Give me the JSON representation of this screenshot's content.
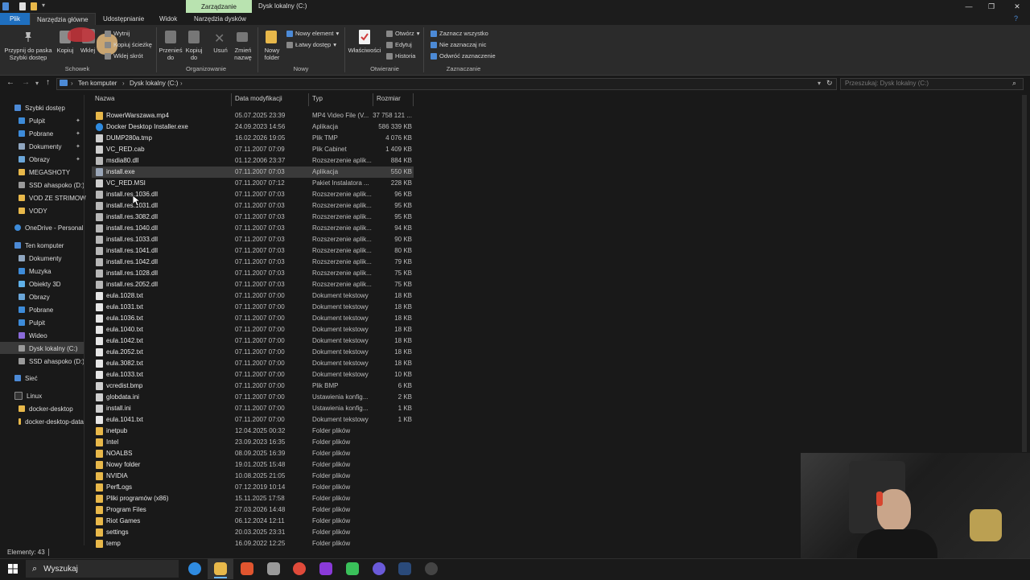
{
  "window": {
    "contextual_tab": "Zarządzanie",
    "title": "Dysk lokalny (C:)",
    "controls": {
      "minimize": "—",
      "restore": "❐",
      "close": "✕"
    }
  },
  "ribbon_tabs": [
    "Plik",
    "Narzędzia główne",
    "Udostępnianie",
    "Widok",
    "Narzędzia dysków"
  ],
  "ribbon": {
    "clipboard": {
      "pin": "Przypnij do paska Szybki dostęp",
      "copy": "Kopiuj",
      "paste": "Wklej",
      "cut": "Wytnij",
      "copy_path": "Kopiuj ścieżkę",
      "paste_shortcut": "Wklej skrót",
      "group": "Schowek"
    },
    "organize": {
      "move_to": "Przenieś do",
      "copy_to": "Kopiuj do",
      "delete": "Usuń",
      "rename": "Zmień nazwę",
      "group": "Organizowanie"
    },
    "new": {
      "new_folder": "Nowy folder",
      "new_item": "Nowy element",
      "easy_access": "Łatwy dostęp",
      "group": "Nowy"
    },
    "open": {
      "properties": "Właściwości",
      "open": "Otwórz",
      "edit": "Edytuj",
      "history": "Historia",
      "group": "Otwieranie"
    },
    "select": {
      "select_all": "Zaznacz wszystko",
      "select_none": "Nie zaznaczaj nic",
      "invert": "Odwróć zaznaczenie",
      "group": "Zaznaczanie"
    }
  },
  "address": {
    "crumbs": [
      "Ten komputer",
      "Dysk lokalny (C:)"
    ],
    "search_placeholder": "Przeszukaj: Dysk lokalny (C:)"
  },
  "sidebar": {
    "quick_access": "Szybki dostęp",
    "quick_items": [
      "Pulpit",
      "Pobrane",
      "Dokumenty",
      "Obrazy",
      "MEGASHOTY",
      "SSD ahaspoko (D:)",
      "VOD ZE STRIMOW",
      "VODY"
    ],
    "onedrive": "OneDrive - Personal",
    "this_pc": "Ten komputer",
    "pc_items": [
      "Dokumenty",
      "Muzyka",
      "Obiekty 3D",
      "Obrazy",
      "Pobrane",
      "Pulpit",
      "Wideo",
      "Dysk lokalny (C:)",
      "SSD ahaspoko (D:)"
    ],
    "network": "Sieć",
    "linux": "Linux",
    "linux_items": [
      "docker-desktop",
      "docker-desktop-data"
    ]
  },
  "columns": {
    "name": "Nazwa",
    "date": "Data modyfikacji",
    "type": "Typ",
    "size": "Rozmiar"
  },
  "files": [
    {
      "name": "RowerWarszawa.mp4",
      "date": "05.07.2025 23:39",
      "type": "MP4 Video File (V...",
      "size": "37 758 121 ...",
      "kind": "video"
    },
    {
      "name": "Docker Desktop Installer.exe",
      "date": "24.09.2023 14:56",
      "type": "Aplikacja",
      "size": "586 339 KB",
      "kind": "docker"
    },
    {
      "name": "DUMP280a.tmp",
      "date": "16.02.2026 19:05",
      "type": "Plik TMP",
      "size": "4 076 KB",
      "kind": "file"
    },
    {
      "name": "VC_RED.cab",
      "date": "07.11.2007 07:09",
      "type": "Plik Cabinet",
      "size": "1 409 KB",
      "kind": "file"
    },
    {
      "name": "msdia80.dll",
      "date": "01.12.2006 23:37",
      "type": "Rozszerzenie aplik...",
      "size": "884 KB",
      "kind": "dll"
    },
    {
      "name": "install.exe",
      "date": "07.11.2007 07:03",
      "type": "Aplikacja",
      "size": "550 KB",
      "kind": "exe",
      "selected": true
    },
    {
      "name": "VC_RED.MSI",
      "date": "07.11.2007 07:12",
      "type": "Pakiet Instalatora ...",
      "size": "228 KB",
      "kind": "file"
    },
    {
      "name": "install.res.1036.dll",
      "date": "07.11.2007 07:03",
      "type": "Rozszerzenie aplik...",
      "size": "96 KB",
      "kind": "dll"
    },
    {
      "name": "install.res.1031.dll",
      "date": "07.11.2007 07:03",
      "type": "Rozszerzenie aplik...",
      "size": "95 KB",
      "kind": "dll"
    },
    {
      "name": "install.res.3082.dll",
      "date": "07.11.2007 07:03",
      "type": "Rozszerzenie aplik...",
      "size": "95 KB",
      "kind": "dll"
    },
    {
      "name": "install.res.1040.dll",
      "date": "07.11.2007 07:03",
      "type": "Rozszerzenie aplik...",
      "size": "94 KB",
      "kind": "dll"
    },
    {
      "name": "install.res.1033.dll",
      "date": "07.11.2007 07:03",
      "type": "Rozszerzenie aplik...",
      "size": "90 KB",
      "kind": "dll"
    },
    {
      "name": "install.res.1041.dll",
      "date": "07.11.2007 07:03",
      "type": "Rozszerzenie aplik...",
      "size": "80 KB",
      "kind": "dll"
    },
    {
      "name": "install.res.1042.dll",
      "date": "07.11.2007 07:03",
      "type": "Rozszerzenie aplik...",
      "size": "79 KB",
      "kind": "dll"
    },
    {
      "name": "install.res.1028.dll",
      "date": "07.11.2007 07:03",
      "type": "Rozszerzenie aplik...",
      "size": "75 KB",
      "kind": "dll"
    },
    {
      "name": "install.res.2052.dll",
      "date": "07.11.2007 07:03",
      "type": "Rozszerzenie aplik...",
      "size": "75 KB",
      "kind": "dll"
    },
    {
      "name": "eula.1028.txt",
      "date": "07.11.2007 07:00",
      "type": "Dokument tekstowy",
      "size": "18 KB",
      "kind": "txt"
    },
    {
      "name": "eula.1031.txt",
      "date": "07.11.2007 07:00",
      "type": "Dokument tekstowy",
      "size": "18 KB",
      "kind": "txt"
    },
    {
      "name": "eula.1036.txt",
      "date": "07.11.2007 07:00",
      "type": "Dokument tekstowy",
      "size": "18 KB",
      "kind": "txt"
    },
    {
      "name": "eula.1040.txt",
      "date": "07.11.2007 07:00",
      "type": "Dokument tekstowy",
      "size": "18 KB",
      "kind": "txt"
    },
    {
      "name": "eula.1042.txt",
      "date": "07.11.2007 07:00",
      "type": "Dokument tekstowy",
      "size": "18 KB",
      "kind": "txt"
    },
    {
      "name": "eula.2052.txt",
      "date": "07.11.2007 07:00",
      "type": "Dokument tekstowy",
      "size": "18 KB",
      "kind": "txt"
    },
    {
      "name": "eula.3082.txt",
      "date": "07.11.2007 07:00",
      "type": "Dokument tekstowy",
      "size": "18 KB",
      "kind": "txt"
    },
    {
      "name": "eula.1033.txt",
      "date": "07.11.2007 07:00",
      "type": "Dokument tekstowy",
      "size": "10 KB",
      "kind": "txt"
    },
    {
      "name": "vcredist.bmp",
      "date": "07.11.2007 07:00",
      "type": "Plik BMP",
      "size": "6 KB",
      "kind": "file"
    },
    {
      "name": "globdata.ini",
      "date": "07.11.2007 07:00",
      "type": "Ustawienia konfig...",
      "size": "2 KB",
      "kind": "file"
    },
    {
      "name": "install.ini",
      "date": "07.11.2007 07:00",
      "type": "Ustawienia konfig...",
      "size": "1 KB",
      "kind": "file"
    },
    {
      "name": "eula.1041.txt",
      "date": "07.11.2007 07:00",
      "type": "Dokument tekstowy",
      "size": "1 KB",
      "kind": "txt"
    },
    {
      "name": "inetpub",
      "date": "12.04.2025 00:32",
      "type": "Folder plików",
      "size": "",
      "kind": "folder"
    },
    {
      "name": "Intel",
      "date": "23.09.2023 16:35",
      "type": "Folder plików",
      "size": "",
      "kind": "folder"
    },
    {
      "name": "NOALBS",
      "date": "08.09.2025 16:39",
      "type": "Folder plików",
      "size": "",
      "kind": "folder"
    },
    {
      "name": "Nowy folder",
      "date": "19.01.2025 15:48",
      "type": "Folder plików",
      "size": "",
      "kind": "folder"
    },
    {
      "name": "NVIDIA",
      "date": "10.08.2025 21:05",
      "type": "Folder plików",
      "size": "",
      "kind": "folder"
    },
    {
      "name": "PerfLogs",
      "date": "07.12.2019 10:14",
      "type": "Folder plików",
      "size": "",
      "kind": "folder"
    },
    {
      "name": "Pliki programów (x86)",
      "date": "15.11.2025 17:58",
      "type": "Folder plików",
      "size": "",
      "kind": "folder"
    },
    {
      "name": "Program Files",
      "date": "27.03.2026 14:48",
      "type": "Folder plików",
      "size": "",
      "kind": "folder"
    },
    {
      "name": "Riot Games",
      "date": "06.12.2024 12:11",
      "type": "Folder plików",
      "size": "",
      "kind": "folder"
    },
    {
      "name": "settings",
      "date": "20.03.2025 23:31",
      "type": "Folder plików",
      "size": "",
      "kind": "folder"
    },
    {
      "name": "temp",
      "date": "16.09.2022 12:25",
      "type": "Folder plików",
      "size": "",
      "kind": "folder"
    }
  ],
  "status": {
    "count": "Elementy: 43"
  },
  "taskbar": {
    "search": "Wyszukaj"
  },
  "colors": {
    "accent": "#1f6fbf",
    "folder": "#e8b84a",
    "selection": "#3a3a3a",
    "ctx_tab": "#b9e3b0"
  }
}
